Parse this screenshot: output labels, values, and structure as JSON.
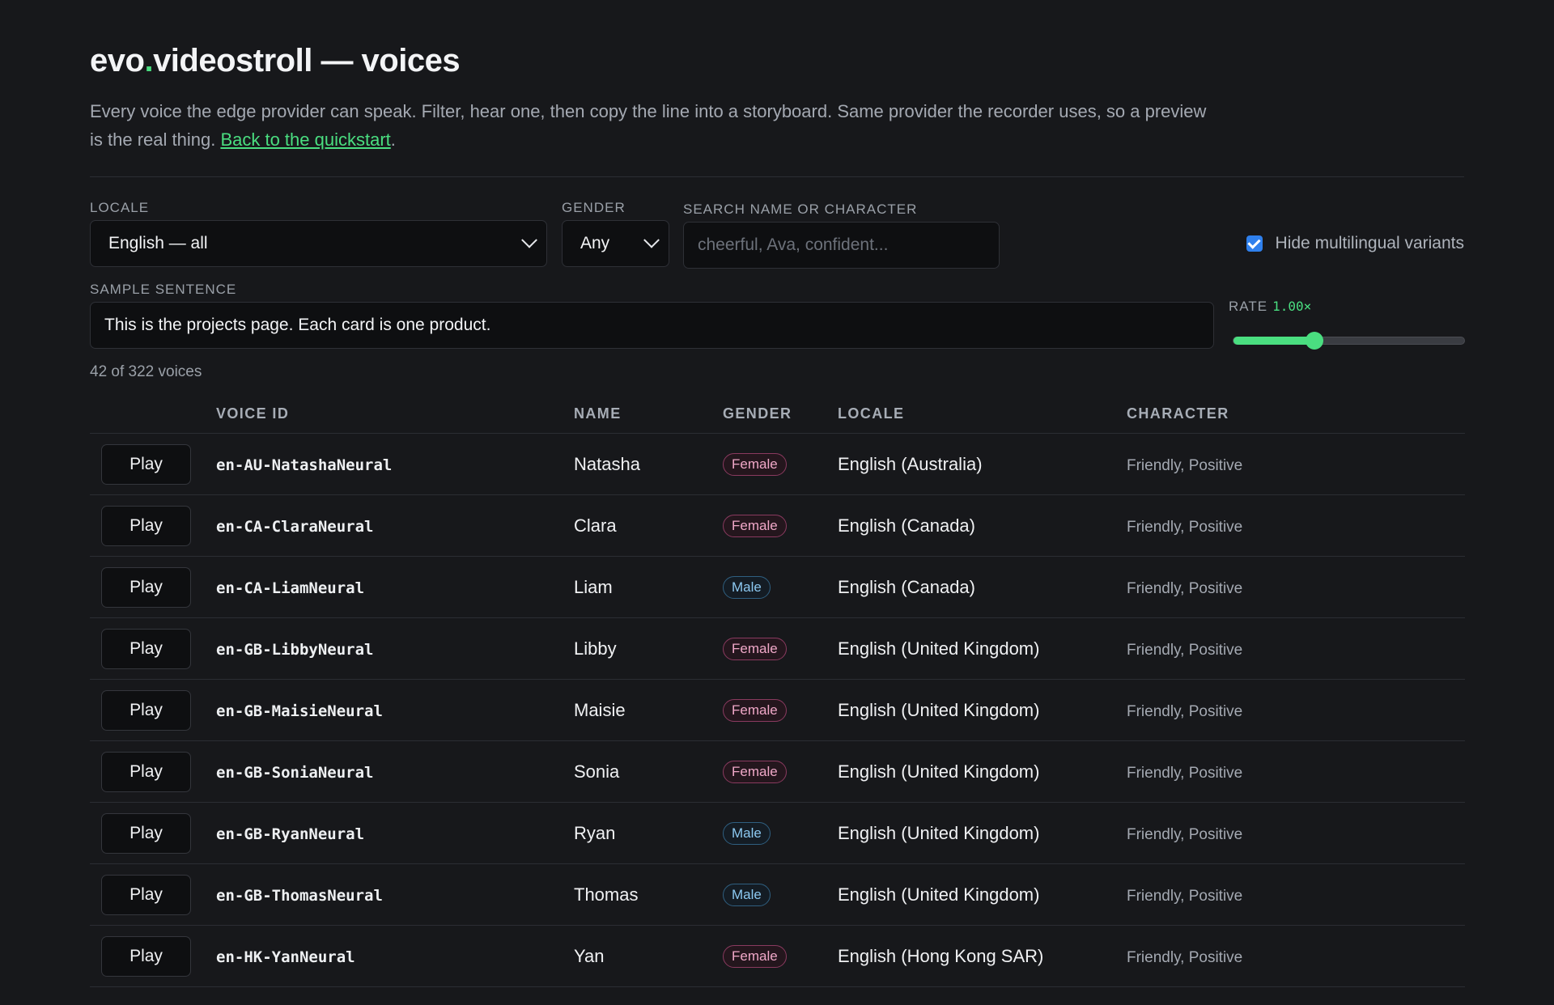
{
  "header": {
    "title_pre": "evo",
    "title_dot": ".",
    "title_post": "videostroll — voices",
    "intro": "Every voice the edge provider can speak. Filter, hear one, then copy the line into a storyboard. Same provider the recorder uses, so a preview is the real thing. ",
    "back_link": "Back to the quickstart",
    "intro_end": "."
  },
  "filters": {
    "locale_label": "Locale",
    "locale_value": "English — all",
    "gender_label": "Gender",
    "gender_value": "Any",
    "search_label": "Search name or character",
    "search_placeholder": "cheerful, Ava, confident...",
    "hide_multilingual_label": "Hide multilingual variants",
    "hide_multilingual_checked": true,
    "sample_label": "Sample sentence",
    "sample_value": "This is the projects page. Each card is one product.",
    "rate_label": "Rate",
    "rate_value": "1.00×",
    "rate_fraction": 0.35
  },
  "count_text": "42 of 322 voices",
  "table": {
    "columns": [
      "",
      "Voice ID",
      "Name",
      "Gender",
      "Locale",
      "Character"
    ],
    "play_label": "Play",
    "rows": [
      {
        "id": "en-AU-NatashaNeural",
        "name": "Natasha",
        "gender": "Female",
        "locale": "English (Australia)",
        "character": "Friendly, Positive"
      },
      {
        "id": "en-CA-ClaraNeural",
        "name": "Clara",
        "gender": "Female",
        "locale": "English (Canada)",
        "character": "Friendly, Positive"
      },
      {
        "id": "en-CA-LiamNeural",
        "name": "Liam",
        "gender": "Male",
        "locale": "English (Canada)",
        "character": "Friendly, Positive"
      },
      {
        "id": "en-GB-LibbyNeural",
        "name": "Libby",
        "gender": "Female",
        "locale": "English (United Kingdom)",
        "character": "Friendly, Positive"
      },
      {
        "id": "en-GB-MaisieNeural",
        "name": "Maisie",
        "gender": "Female",
        "locale": "English (United Kingdom)",
        "character": "Friendly, Positive"
      },
      {
        "id": "en-GB-SoniaNeural",
        "name": "Sonia",
        "gender": "Female",
        "locale": "English (United Kingdom)",
        "character": "Friendly, Positive"
      },
      {
        "id": "en-GB-RyanNeural",
        "name": "Ryan",
        "gender": "Male",
        "locale": "English (United Kingdom)",
        "character": "Friendly, Positive"
      },
      {
        "id": "en-GB-ThomasNeural",
        "name": "Thomas",
        "gender": "Male",
        "locale": "English (United Kingdom)",
        "character": "Friendly, Positive"
      },
      {
        "id": "en-HK-YanNeural",
        "name": "Yan",
        "gender": "Female",
        "locale": "English (Hong Kong SAR)",
        "character": "Friendly, Positive"
      }
    ]
  },
  "colors": {
    "background": "#17181b",
    "accent": "#4ade80",
    "female_badge": "#f0a8c8",
    "male_badge": "#8cc8f0",
    "checkbox": "#2f80ed"
  }
}
